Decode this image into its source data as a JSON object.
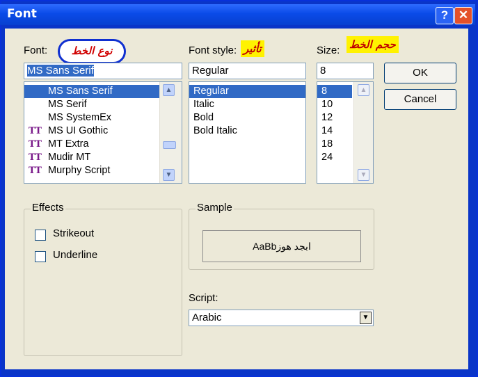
{
  "window": {
    "title": "Font",
    "help_glyph": "?",
    "close_glyph": "✕"
  },
  "font": {
    "label": "Font:",
    "annotation": "نوع الخط",
    "value": "MS Sans Serif",
    "items": [
      {
        "name": "MS Sans Serif",
        "truetype": false,
        "selected": true
      },
      {
        "name": "MS Serif",
        "truetype": false,
        "selected": false
      },
      {
        "name": "MS SystemEx",
        "truetype": false,
        "selected": false
      },
      {
        "name": "MS UI Gothic",
        "truetype": true,
        "selected": false
      },
      {
        "name": "MT Extra",
        "truetype": true,
        "selected": false
      },
      {
        "name": "Mudir MT",
        "truetype": true,
        "selected": false
      },
      {
        "name": "Murphy Script",
        "truetype": true,
        "selected": false
      }
    ]
  },
  "style": {
    "label": "Font style:",
    "annotation": "تأثير",
    "value": "Regular",
    "items": [
      "Regular",
      "Italic",
      "Bold",
      "Bold Italic"
    ]
  },
  "size": {
    "label": "Size:",
    "annotation": "حجم الخط",
    "value": "8",
    "items": [
      "8",
      "10",
      "12",
      "14",
      "18",
      "24"
    ]
  },
  "buttons": {
    "ok": "OK",
    "cancel": "Cancel"
  },
  "effects": {
    "legend": "Effects",
    "strikeout": "Strikeout",
    "underline": "Underline"
  },
  "sample": {
    "legend": "Sample",
    "text": "AaBbابجد هوز"
  },
  "script": {
    "label": "Script:",
    "value": "Arabic"
  },
  "icons": {
    "truetype": "TT",
    "scroll_up": "▲",
    "scroll_down": "▼",
    "dropdown": "▼"
  }
}
